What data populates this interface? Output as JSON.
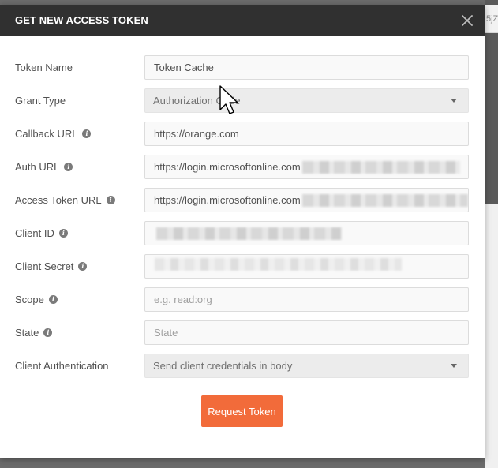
{
  "background": {
    "tab_fragment": "5jZ"
  },
  "modal": {
    "title": "GET NEW ACCESS TOKEN",
    "close_icon": "close-x-icon"
  },
  "form": {
    "token_name": {
      "label": "Token Name",
      "value": "Token Cache"
    },
    "grant_type": {
      "label": "Grant Type",
      "value": "Authorization Code"
    },
    "callback_url": {
      "label": "Callback URL",
      "value": "https://orange.com"
    },
    "auth_url": {
      "label": "Auth URL",
      "value": "https://login.microsoftonline.com"
    },
    "access_token_url": {
      "label": "Access Token URL",
      "value": "https://login.microsoftonline.com"
    },
    "client_id": {
      "label": "Client ID",
      "value": ""
    },
    "client_secret": {
      "label": "Client Secret",
      "value": ""
    },
    "scope": {
      "label": "Scope",
      "placeholder": "e.g. read:org"
    },
    "state": {
      "label": "State",
      "placeholder": "State"
    },
    "client_authentication": {
      "label": "Client Authentication",
      "value": "Send client credentials in body"
    }
  },
  "actions": {
    "request_token": "Request Token"
  },
  "colors": {
    "header_bg": "#303030",
    "primary": "#f26b3a"
  }
}
